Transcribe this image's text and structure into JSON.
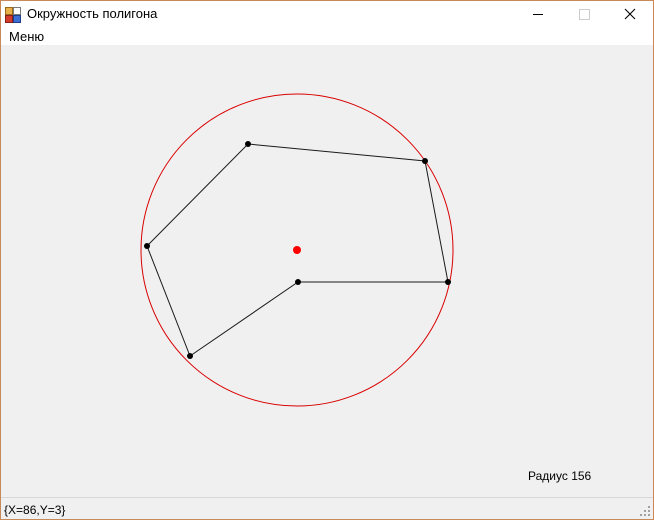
{
  "window": {
    "title": "Окружность полигона",
    "controls": {
      "minimize": "minimize-icon",
      "maximize": "maximize-icon",
      "close": "close-icon"
    }
  },
  "menu": {
    "items": [
      {
        "label": "Меню"
      }
    ]
  },
  "drawing": {
    "circle_color": "#d90000",
    "center_color": "#ff0000",
    "polygon_color": "#000000",
    "background": "#f0f0f0"
  },
  "radius": {
    "label": "Радиус",
    "value": "156"
  },
  "status": {
    "text": "{X=86,Y=3}"
  }
}
